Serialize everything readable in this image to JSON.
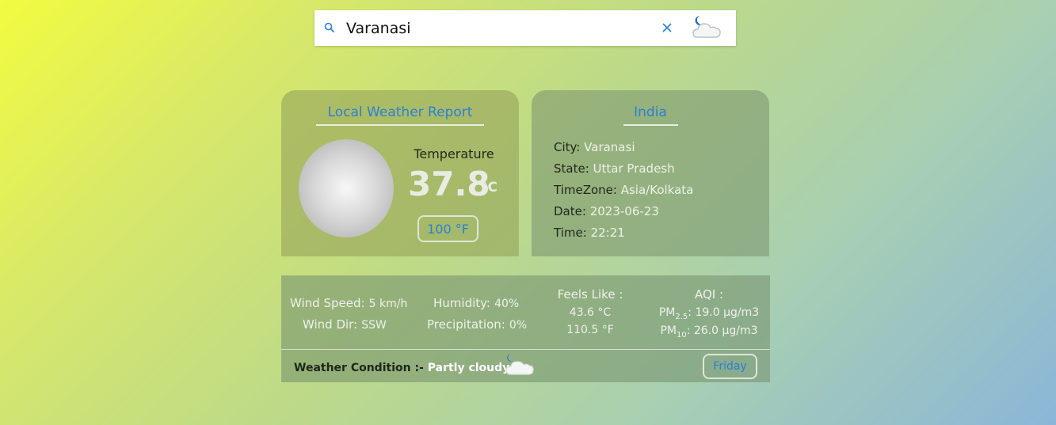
{
  "search": {
    "value": "Varanasi",
    "placeholder": ""
  },
  "local_report": {
    "title": "Local Weather Report",
    "temperature_label": "Temperature",
    "temperature_c": "37.8",
    "temperature_c_unit": "°C",
    "temperature_f_button": "100 °F"
  },
  "location": {
    "country": "India",
    "rows": [
      {
        "key": "City:",
        "value": "Varanasi"
      },
      {
        "key": "State:",
        "value": "Uttar Pradesh"
      },
      {
        "key": "TimeZone:",
        "value": "Asia/Kolkata"
      },
      {
        "key": "Date:",
        "value": "2023-06-23"
      },
      {
        "key": "Time:",
        "value": "22:21"
      }
    ]
  },
  "details": {
    "wind_speed_key": "Wind Speed:",
    "wind_speed_val": "5 km/h",
    "wind_dir_key": "Wind Dir:",
    "wind_dir_val": "SSW",
    "humidity_key": "Humidity:",
    "humidity_val": "40%",
    "precip_key": "Precipitation:",
    "precip_val": "0%",
    "feels_like_head": "Feels Like :",
    "feels_like_c": "43.6 °C",
    "feels_like_f": "110.5 °F",
    "aqi_head": "AQI :",
    "pm25_prefix": "PM",
    "pm25_sub": "2.5",
    "pm25_val": ": 19.0 µg/m3",
    "pm10_prefix": "PM",
    "pm10_sub": "10",
    "pm10_val": ": 26.0 µg/m3"
  },
  "condition": {
    "label": "Weather Condition :- ",
    "value": "Partly cloudy",
    "day_button": "Friday"
  },
  "colors": {
    "accent": "#2b7fd6",
    "moon": "#1e6fd0"
  }
}
